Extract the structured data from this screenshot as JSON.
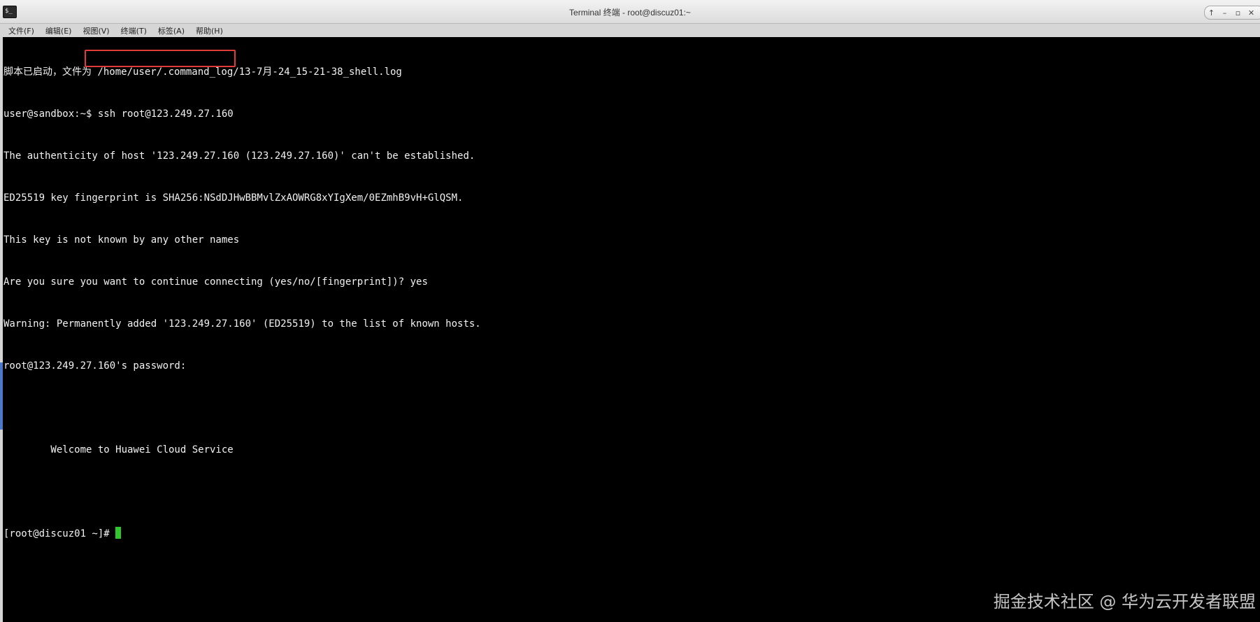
{
  "window": {
    "title": "Terminal 终端 - root@discuz01:~",
    "controls": [
      "↑",
      "–",
      "▫",
      "✕"
    ]
  },
  "menu": [
    "文件(F)",
    "编辑(E)",
    "视图(V)",
    "终端(T)",
    "标签(A)",
    "帮助(H)"
  ],
  "terminal": {
    "lines": [
      "脚本已启动，文件为 /home/user/.command_log/13-7月-24_15-21-38_shell.log",
      "",
      "The authenticity of host '123.249.27.160 (123.249.27.160)' can't be established.",
      "ED25519 key fingerprint is SHA256:NSdDJHwBBMvlZxAOWRG8xYIgXem/0EZmhB9vH+GlQSM.",
      "This key is not known by any other names",
      "Are you sure you want to continue connecting (yes/no/[fingerprint])? yes",
      "Warning: Permanently added '123.249.27.160' (ED25519) to the list of known hosts.",
      "root@123.249.27.160's password:",
      "",
      "        Welcome to Huawei Cloud Service",
      "",
      ""
    ],
    "ssh_prompt": "user@sandbox:~$",
    "ssh_command": "ssh root@123.249.27.160",
    "root_prompt": "[root@discuz01 ~]#"
  },
  "watermark": "掘金技术社区 @ 华为云开发者联盟",
  "colors": {
    "terminal_bg": "#000000",
    "terminal_fg": "#f2f2f2",
    "cursor": "#2ec72e",
    "highlight": "#e23b3b"
  }
}
